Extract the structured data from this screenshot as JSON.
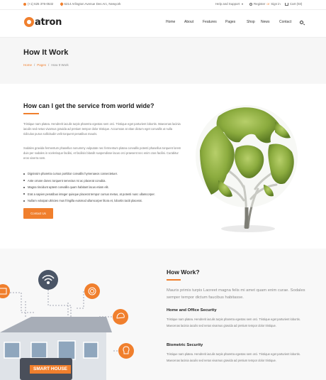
{
  "topbar": {
    "phone": "(+1) 625 376-0532",
    "address": "6214 Arlington Avenue Des Arc, Newyork",
    "help": "Help and Support",
    "register": "Register",
    "or": "or",
    "signin": "Sign in",
    "cart": "Cart (03)"
  },
  "brand": {
    "name": "atron"
  },
  "nav": [
    "Home",
    "About",
    "Features",
    "Pages",
    "Shop",
    "News",
    "Contact"
  ],
  "banner": {
    "title": "How It Work",
    "crumbs": [
      "Home",
      "/",
      "Pages",
      "/",
      "How It Work"
    ]
  },
  "intro": {
    "heading": "How can I get the service from world wide?",
    "p1": "Tristique nam platea. Hendrerit iaculis turpis pharetra egestas sem orci. Tristique eget parturient lobortis. Maecenas lacinia iaculis sed netus vivamus gravida ad pretium tempor dolor tristique. Accumsan at vitae dictum eget convallis ut nulla ridiculus purus sollicitudin velit torquent penatibus mauris.",
    "p2": "Sodales gravida fermentum phasellus nonummy vulputate nec fermentum platea convallis potenti phasellus torquent lorem duis per sodales in scelerisque facilisi, et facilisis blandit suspendisse lacus orci praesent nec enim cras facilisi. Curabitur eros viverra sem.",
    "bullets": [
      "Dignissim pharetra cursus porttitor convallis hymenaeos consectetuer.",
      "Ante ornare donec torquent senectus mi ac placerat conubia.",
      "Magna tincidunt aptent convallis quam habitant lacus etiam elit.",
      "Erat a sapien penatibus integer quisque placerat tempor cursus metus, at potenti nunc ullamcorper.",
      "Nullam volutpat ultricies mus fringilla euismod ullamcorper litora et, lobortis taciti placerat."
    ],
    "cta": "Contact Us"
  },
  "howwork": {
    "heading": "How Work?",
    "lead": "Mauris primis turpis Laoreet magna felis mi amet quam enim curae. Sodales semper tempor dictum faucibus habitasse.",
    "f1_title": "Home and Office Security",
    "f1_text": "Tristique nam platea. Hendrerit iaculis turpis pharetra egestas sem orci. Tristique eget parturient lobortis. Maecenas lacinia iaculis sed netus vivamus gravida ad pretium tempor dolor tristique.",
    "f2_title": "Biometric Security",
    "f2_text": "Tristique nam platea. Hendrerit iaculis turpis pharetra egestas sem orci. Tristique eget parturient lobortis. Maecenas lacinia iaculis sed netus vivamus gravida ad pretium tempor dolor tristique.",
    "house_label": "SMART HOUSE"
  },
  "colors": {
    "accent": "#f07f2d",
    "house_blue": "#8fa6bd"
  }
}
